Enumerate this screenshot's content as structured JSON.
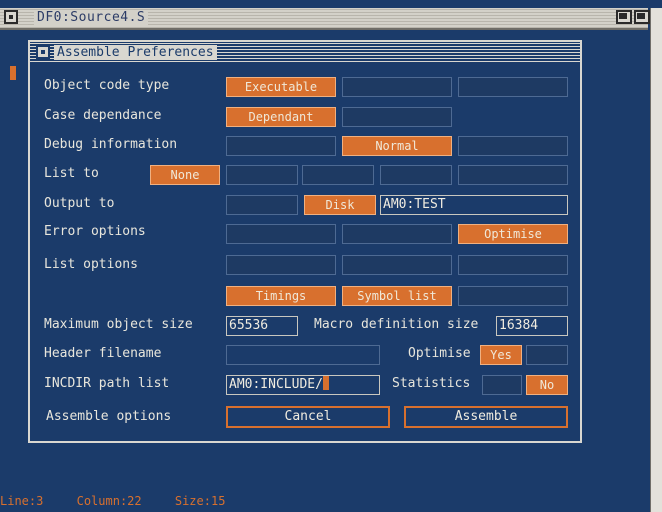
{
  "window": {
    "title": "DF0:Source4.S"
  },
  "dialog": {
    "title": "Assemble Preferences",
    "rows": {
      "object_code_type": {
        "label": "Object code type",
        "selected": "Executable"
      },
      "case_dependance": {
        "label": "Case dependance",
        "selected": "Dependant"
      },
      "debug_information": {
        "label": "Debug information",
        "selected": "Normal"
      },
      "list_to": {
        "label": "List to",
        "selected": "None"
      },
      "output_to": {
        "label": "Output to",
        "selected": "Disk",
        "path": "AM0:TEST"
      },
      "error_options": {
        "label": "Error options",
        "selected": "Optimise"
      },
      "list_options": {
        "label": "List options",
        "selected_1": "Timings",
        "selected_2": "Symbol list"
      },
      "max_object_size": {
        "label": "Maximum object size",
        "value": "65536"
      },
      "macro_definition_size": {
        "label": "Macro definition size",
        "value": "16384"
      },
      "header_filename": {
        "label": "Header filename",
        "value": ""
      },
      "optimise": {
        "label": "Optimise",
        "selected": "Yes"
      },
      "incdir": {
        "label": "INCDIR path list",
        "value": "AM0:INCLUDE/"
      },
      "statistics": {
        "label": "Statistics",
        "selected": "No"
      },
      "assemble_options": {
        "label": "Assemble options"
      }
    },
    "buttons": {
      "cancel": "Cancel",
      "assemble": "Assemble"
    }
  },
  "status": {
    "line": "Line:3",
    "column": "Column:22",
    "size": "Size:15"
  },
  "colors": {
    "background": "#1b3b6a",
    "accent": "#d8702e",
    "frame": "#d9d7d0"
  },
  "icons": [
    "close-gadget-icon",
    "depth-gadget-icon"
  ]
}
